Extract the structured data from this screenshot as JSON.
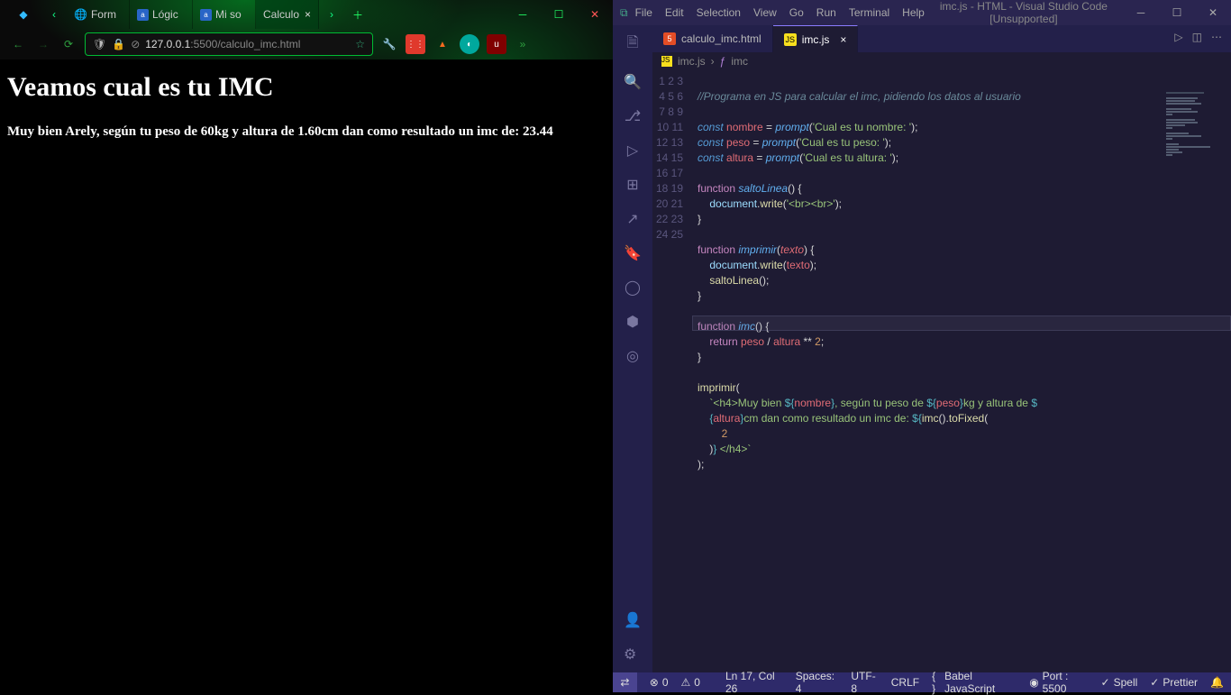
{
  "browser": {
    "tabs": [
      {
        "label": "Form"
      },
      {
        "label": "Lógic"
      },
      {
        "label": "Mi so"
      },
      {
        "label": "Calculo"
      }
    ],
    "url_host": "127.0.0.1",
    "url_port": ":5500",
    "url_path": "/calculo_imc.html",
    "page_heading": "Veamos cual es tu IMC",
    "page_result": "Muy bien Arely, según tu peso de 60kg y altura de 1.60cm dan como resultado un imc de: 23.44"
  },
  "vscode": {
    "menu": [
      "File",
      "Edit",
      "Selection",
      "View",
      "Go",
      "Run",
      "Terminal",
      "Help"
    ],
    "title": "imc.js - HTML - Visual Studio Code [Unsupported]",
    "tabs": [
      {
        "label": "calculo_imc.html",
        "icon": "html"
      },
      {
        "label": "imc.js",
        "icon": "js"
      }
    ],
    "breadcrumb": [
      "imc.js",
      "imc"
    ],
    "code": {
      "l1_comment": "//Programa en JS para calcular el imc, pidiendo los datos al usuario",
      "const": "const",
      "function": "function",
      "return": "return",
      "nombre": "nombre",
      "peso": "peso",
      "altura": "altura",
      "prompt": "prompt",
      "saltoLinea": "saltoLinea",
      "imprimir": "imprimir",
      "imc": "imc",
      "document": "document",
      "write": "write",
      "texto": "texto",
      "toFixed": "toFixed",
      "s_nombre": "'Cual es tu nombre: '",
      "s_peso": "'Cual es tu peso: '",
      "s_altura": "'Cual es tu altura: '",
      "s_br": "'<br><br>'",
      "tmpl1": "`<h4>Muy bien ",
      "tmpl2": ", según tu peso de ",
      "tmpl3": "kg y altura de ",
      "tmpl4": "cm dan como resultado un imc de: ",
      "tmpl5": " </h4>`",
      "two": "2"
    },
    "status": {
      "errors": "0",
      "warnings": "0",
      "ln": "Ln 17, Col 26",
      "spaces": "Spaces: 4",
      "enc": "UTF-8",
      "eol": "CRLF",
      "lang": "Babel JavaScript",
      "port": "Port : 5500",
      "spell": "Spell",
      "prettier": "Prettier"
    }
  }
}
